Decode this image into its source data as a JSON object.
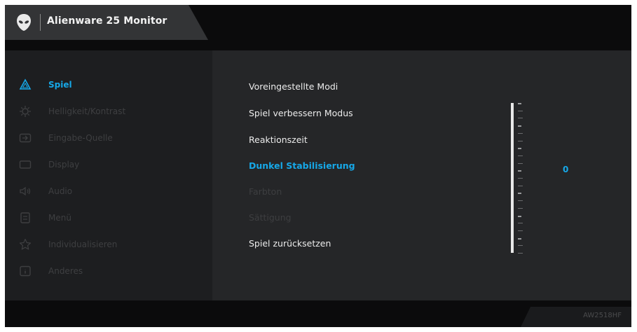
{
  "header": {
    "title": "Alienware 25 Monitor",
    "logo_icon": "alien-head-icon"
  },
  "sidebar": {
    "items": [
      {
        "label": "Spiel",
        "icon": "game-triangle-icon",
        "active": true
      },
      {
        "label": "Helligkeit/Kontrast",
        "icon": "brightness-icon",
        "active": false
      },
      {
        "label": "Eingabe-Quelle",
        "icon": "input-source-icon",
        "active": false
      },
      {
        "label": "Display",
        "icon": "display-icon",
        "active": false
      },
      {
        "label": "Audio",
        "icon": "speaker-icon",
        "active": false
      },
      {
        "label": "Menü",
        "icon": "menu-icon",
        "active": false
      },
      {
        "label": "Individualisieren",
        "icon": "star-icon",
        "active": false
      },
      {
        "label": "Anderes",
        "icon": "info-icon",
        "active": false
      }
    ]
  },
  "main": {
    "options": [
      {
        "label": "Voreingestellte Modi",
        "state": "normal"
      },
      {
        "label": "Spiel verbessern Modus",
        "state": "normal"
      },
      {
        "label": "Reaktionszeit",
        "state": "normal"
      },
      {
        "label": "Dunkel Stabilisierung",
        "state": "selected"
      },
      {
        "label": "Farbton",
        "state": "disabled"
      },
      {
        "label": "Sättigung",
        "state": "disabled"
      },
      {
        "label": "Spiel zurücksetzen",
        "state": "normal"
      }
    ],
    "slider": {
      "value": "0",
      "level_fraction": 0.0
    }
  },
  "footer": {
    "model": "AW2518HF"
  },
  "colors": {
    "accent": "#16a8e8",
    "background": "#0b0b0c",
    "sidebar": "#1d1e20",
    "panel": "#252628"
  }
}
